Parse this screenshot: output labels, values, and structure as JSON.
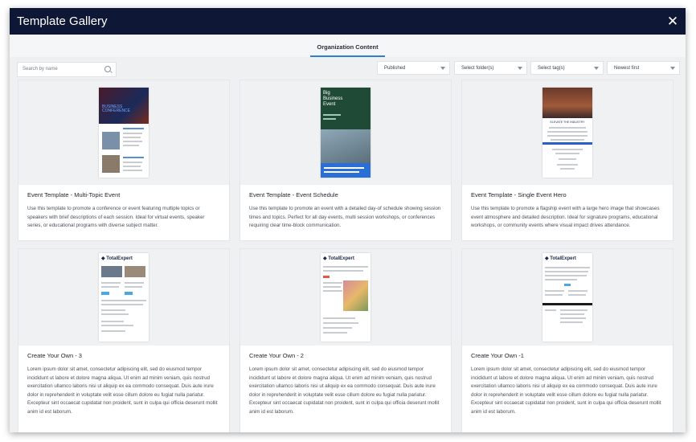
{
  "window": {
    "title": "Template Gallery",
    "close_icon": "close-icon"
  },
  "tabs": [
    {
      "label": "Organization Content",
      "active": true
    }
  ],
  "filters": {
    "search_placeholder": "Search by name",
    "status": "Published",
    "folder": "Select folder(s)",
    "tags": "Select tag(s)",
    "sort": "Newest first"
  },
  "cards": [
    {
      "title": "Event Template - Multi-Topic Event",
      "description": "Use this template to promote a conference or event featuring multiple topics or speakers with brief descriptions of each session. Ideal for virtual events, speaker series, or educational programs with diverse subject matter.",
      "preview": {
        "heading": "Business Conference"
      }
    },
    {
      "title": "Event Template - Event Schedule",
      "description": "Use this template to promote an event with a detailed day-of schedule showing session times and topics. Perfect for all day events, multi session workshops, or conferences requiring clear time-block communication.",
      "preview": {
        "heading": "Big Business Event"
      }
    },
    {
      "title": "Event Template - Single Event Hero",
      "description": "Use this template to promote a flagship event with a large hero image that showcases event atmosphere and detailed description. Ideal for signature programs, educational workshops, or community events where visual impact drives attendance.",
      "preview": {
        "heading": "ELEVATE THE INDUSTRY"
      }
    },
    {
      "title": "Create Your Own - 3",
      "description": "Lorem ipsum dolor sit amet, consectetur adipiscing elit, sed do eiusmod tempor incididunt ut labore et dolore magna aliqua. Ut enim ad minim veniam, quis nostrud exercitation ullamco laboris nisi ut aliquip ex ea commodo consequat. Duis aute irure dolor in reprehenderit in voluptate velit esse cillum dolore eu fugiat nulla pariatur. Excepteur sint occaecat cupidatat non proident, sunt in culpa qui officia deserunt mollit anim id est laborum.",
      "preview": {
        "logo": "TotalExpert"
      }
    },
    {
      "title": "Create Your Own - 2",
      "description": "Lorem ipsum dolor sit amet, consectetur adipiscing elit, sed do eiusmod tempor incididunt ut labore et dolore magna aliqua. Ut enim ad minim veniam, quis nostrud exercitation ullamco laboris nisi ut aliquip ex ea commodo consequat. Duis aute irure dolor in reprehenderit in voluptate velit esse cillum dolore eu fugiat nulla pariatur. Excepteur sint occaecat cupidatat non proident, sunt in culpa qui officia deserunt mollit anim id est laborum.",
      "preview": {
        "logo": "TotalExpert"
      }
    },
    {
      "title": "Create Your Own -1",
      "description": "Lorem ipsum dolor sit amet, consectetur adipiscing elit, sed do eiusmod tempor incididunt ut labore et dolore magna aliqua. Ut enim ad minim veniam, quis nostrud exercitation ullamco laboris nisi ut aliquip ex ea commodo consequat. Duis aute irure dolor in reprehenderit in voluptate velit esse cillum dolore eu fugiat nulla pariatur. Excepteur sint occaecat cupidatat non proident, sunt in culpa qui officia deserunt mollit anim id est laborum.",
      "preview": {
        "logo": "TotalExpert"
      }
    }
  ],
  "colors": {
    "titlebar": "#0e1736",
    "accent": "#2f7fd0",
    "background": "#eef0f2"
  }
}
